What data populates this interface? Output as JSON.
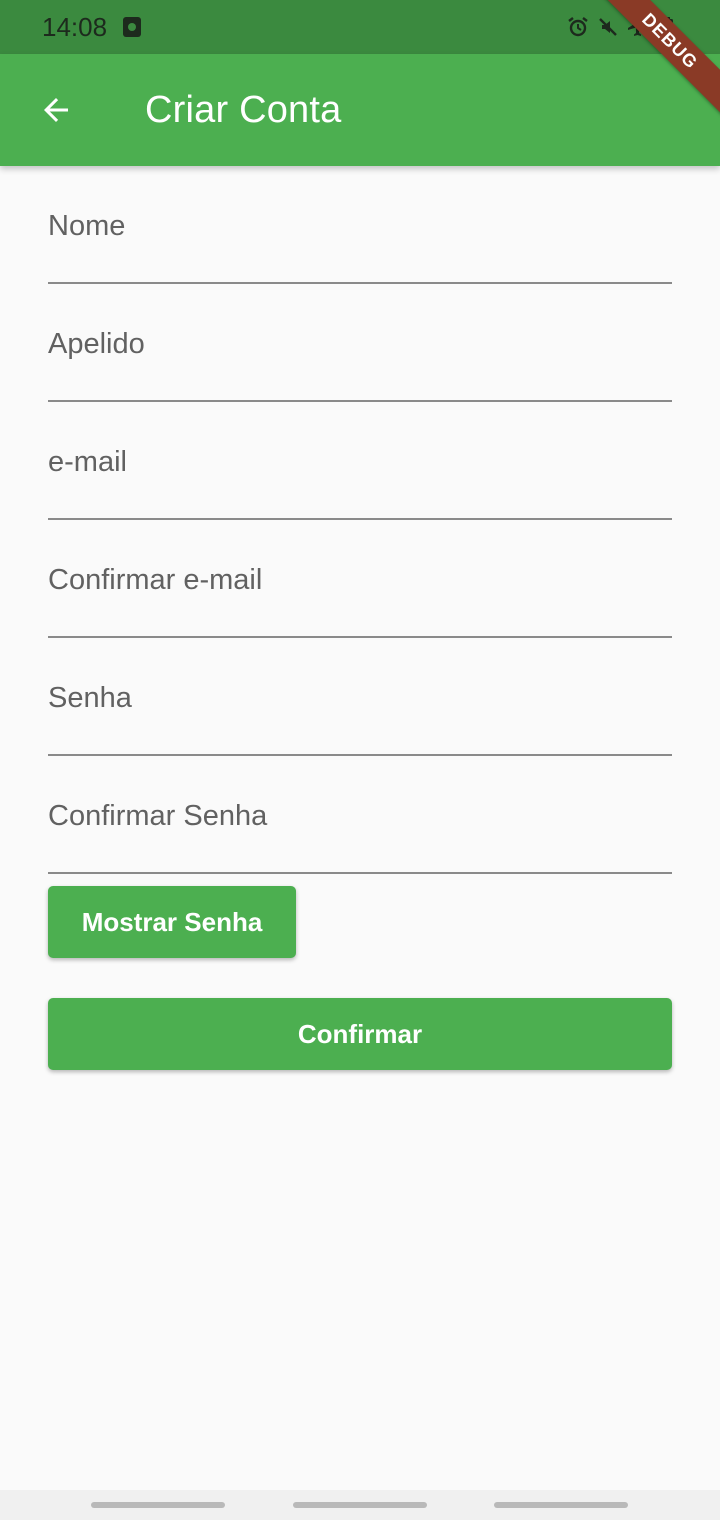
{
  "status_bar": {
    "time": "14:08",
    "left_icon": "photo-icon",
    "right_icons": [
      "alarm-icon",
      "mute-icon",
      "airplane-icon",
      "battery-icon"
    ]
  },
  "app_bar": {
    "back_icon": "arrow-left-icon",
    "title": "Criar Conta"
  },
  "debug_banner": "DEBUG",
  "form": {
    "fields": [
      {
        "label": "Nome",
        "value": ""
      },
      {
        "label": "Apelido",
        "value": ""
      },
      {
        "label": "e-mail",
        "value": ""
      },
      {
        "label": "Confirmar e-mail",
        "value": ""
      },
      {
        "label": "Senha",
        "value": ""
      },
      {
        "label": "Confirmar Senha",
        "value": ""
      }
    ],
    "show_password_label": "Mostrar Senha",
    "confirm_label": "Confirmar"
  },
  "colors": {
    "primary": "#4caf50",
    "status_bar": "#3b8a3f",
    "background": "#fafafa",
    "debug_banner": "#8a3a26"
  }
}
